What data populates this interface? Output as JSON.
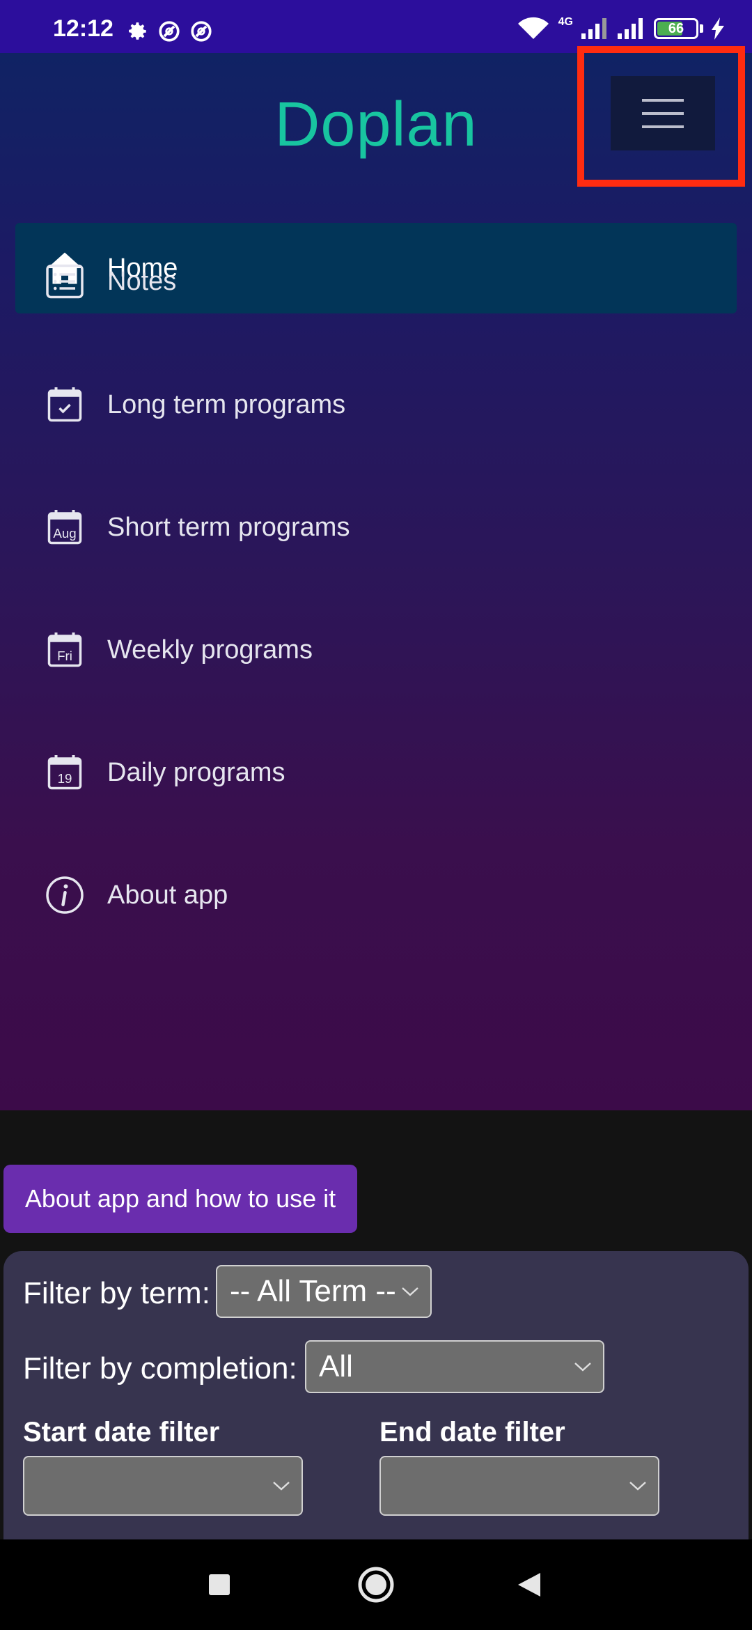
{
  "status_bar": {
    "time": "12:12",
    "network": "4G",
    "battery": "66",
    "battery_level_percent": 66,
    "icons": [
      "gear-icon",
      "dnd-icon",
      "dnd-icon",
      "wifi-icon",
      "signal-icon",
      "signal-icon",
      "battery-icon",
      "charging-icon"
    ]
  },
  "app": {
    "title": "Doplan",
    "accent": "#18c5a0"
  },
  "menu_button": {
    "icon": "hamburger-icon",
    "highlight_color": "#ff2c10"
  },
  "nav": {
    "items": [
      {
        "label": "Home",
        "icon": "home-icon",
        "active": true
      },
      {
        "label": "Notes",
        "icon": "list-icon"
      },
      {
        "label": "Long term programs",
        "icon": "calendar-check-icon"
      },
      {
        "label": "Short term programs",
        "icon": "calendar-aug-icon",
        "icon_text": "Aug"
      },
      {
        "label": "Weekly programs",
        "icon": "calendar-fri-icon",
        "icon_text": "Fri"
      },
      {
        "label": "Daily programs",
        "icon": "calendar-day-icon",
        "icon_text": "19"
      },
      {
        "label": "About app",
        "icon": "info-icon"
      }
    ]
  },
  "content": {
    "about_button": "About app and how to use it",
    "filter_term_label": "Filter by term:",
    "filter_term_value": "-- All Term --",
    "filter_completion_label": "Filter by completion:",
    "filter_completion_value": "All",
    "start_date_label": "Start date filter",
    "end_date_label": "End date filter"
  },
  "nav_bar": {
    "icons": [
      "recents-icon",
      "home-circle-icon",
      "back-icon"
    ]
  }
}
